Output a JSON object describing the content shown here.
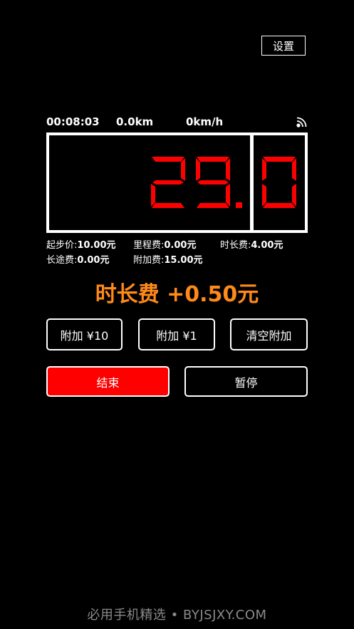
{
  "header": {
    "settings_label": "设置"
  },
  "status": {
    "elapsed": "00:08:03",
    "distance": "0.0km",
    "speed": "0km/h",
    "signal_icon": "signal-icon"
  },
  "meter": {
    "fare_integer": "29",
    "fare_decimal": "0",
    "digit_color": "#ff0000"
  },
  "fees": {
    "base_label": "起步价:",
    "base_value": "10.00元",
    "mileage_label": "里程费:",
    "mileage_value": "0.00元",
    "time_label": "时长费:",
    "time_value": "4.00元",
    "longdist_label": "长途费:",
    "longdist_value": "0.00元",
    "extra_label": "附加费:",
    "extra_value": "15.00元"
  },
  "surcharge_text": "时长费 +0.50元",
  "actions": {
    "add10_label": "附加 ¥10",
    "add1_label": "附加 ¥1",
    "clear_label": "清空附加",
    "end_label": "结束",
    "pause_label": "暂停"
  },
  "colors": {
    "accent_orange": "#ff8a1a",
    "danger_red": "#ff0000"
  },
  "watermark": "必用手机精选 • BYJSJXY.COM"
}
